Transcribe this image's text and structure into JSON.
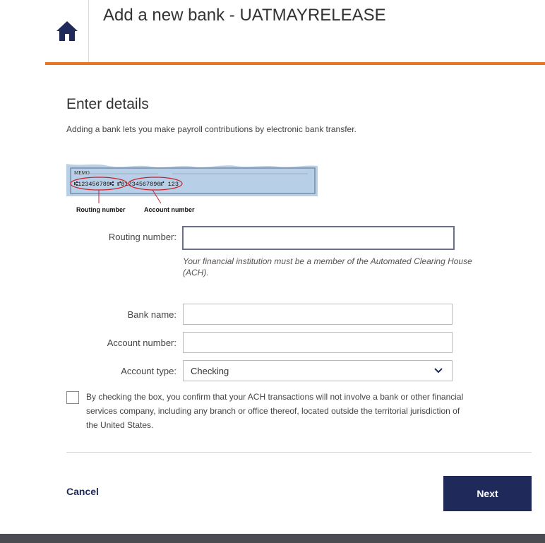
{
  "header": {
    "title": "Add a new bank - UATMAYRELEASE",
    "home_icon": "home-icon",
    "accent": "#e87722"
  },
  "main": {
    "heading": "Enter details",
    "intro": "Adding a bank lets you make payroll contributions by electronic bank transfer."
  },
  "check_image": {
    "memo": "MEMO",
    "micr": "⑆123456789⑆  ⑈01234567890⑈  123",
    "routing_label": "Routing number",
    "account_label": "Account number"
  },
  "form": {
    "routing_label": "Routing number:",
    "routing_value": "",
    "routing_hint": "Your financial institution must be a member of the Automated Clearing House (ACH).",
    "bank_label": "Bank name:",
    "bank_value": "",
    "account_label": "Account number:",
    "account_value": "",
    "type_label": "Account type:",
    "type_value": "Checking"
  },
  "consent": {
    "checked": false,
    "text": "By checking the box, you confirm that your ACH transactions will not involve a bank or other financial services company, including any branch or office thereof, located outside the territorial jurisdiction of the United States."
  },
  "actions": {
    "cancel": "Cancel",
    "next": "Next"
  },
  "colors": {
    "primary": "#1f2a5a",
    "footer": "#4a4c52"
  }
}
